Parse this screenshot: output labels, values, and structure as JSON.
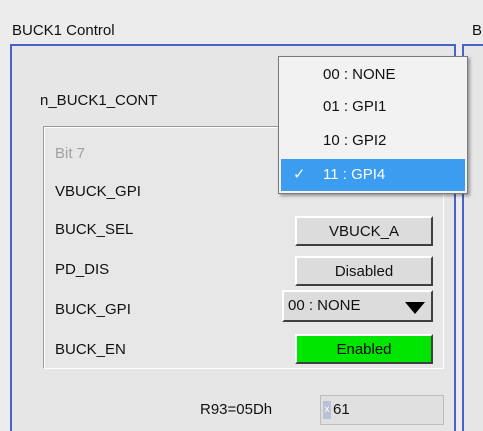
{
  "header": {
    "title": "BUCK1 Control",
    "next_title": "B"
  },
  "register": {
    "name": "n_BUCK1_CONT",
    "address_label": "R93=05Dh",
    "radix": "x",
    "value": "61"
  },
  "fields": {
    "bit7": "Bit 7",
    "vbuck_gpi": "VBUCK_GPI",
    "buck_sel": "BUCK_SEL",
    "pd_dis": "PD_DIS",
    "buck_gpi": "BUCK_GPI",
    "buck_en": "BUCK_EN"
  },
  "controls": {
    "buck_sel_value": "VBUCK_A",
    "pd_dis_value": "Disabled",
    "buck_gpi_value": "00 : NONE",
    "buck_en_value": "Enabled"
  },
  "dropdown": {
    "options": [
      "00 : NONE",
      "01 : GPI1",
      "10 : GPI2",
      "11 : GPI4"
    ],
    "selected_index": 3,
    "check_mark": "✓"
  },
  "colors": {
    "panel_border": "#4a63c8",
    "enabled_green": "#00e600",
    "selection_blue": "#3b9cf0"
  }
}
